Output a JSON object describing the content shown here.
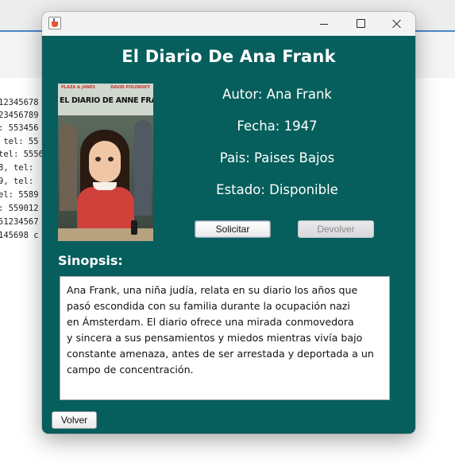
{
  "background": {
    "lines": [
      "12345678",
      "23456789",
      ": 553456",
      " tel: 55",
      "tel: 5556",
      "8, tel: ",
      "9, tel: ",
      "el: 5589",
      ": 559012",
      "51234567",
      "145698 c"
    ]
  },
  "window": {
    "title": "",
    "icon": "java-cup-icon"
  },
  "book": {
    "title": "El Diario De Ana Frank",
    "cover": {
      "publisher": "PLAZA & JANÉS",
      "illustrator": "DAVID POLONSKY",
      "title": "EL DIARIO DE ANNE FRANK"
    },
    "author": "Autor: Ana Frank",
    "date": "Fecha: 1947",
    "country": "Pais: Paises Bajos",
    "status": "Estado: Disponible"
  },
  "buttons": {
    "request": "Solicitar",
    "return": "Devolver",
    "back": "Volver"
  },
  "synopsis": {
    "label": "Sinopsis:",
    "text": "Ana Frank, una niña judía, relata en su diario los años que\npasó escondida con su familia durante la ocupación nazi\nen Ámsterdam. El diario ofrece una mirada conmovedora\ny sincera a sus pensamientos y miedos mientras vivía bajo\nconstante amenaza, antes de ser arrestada y deportada a un\ncampo de concentración."
  },
  "colors": {
    "panel": "#065f5c",
    "text": "#ffffff"
  }
}
